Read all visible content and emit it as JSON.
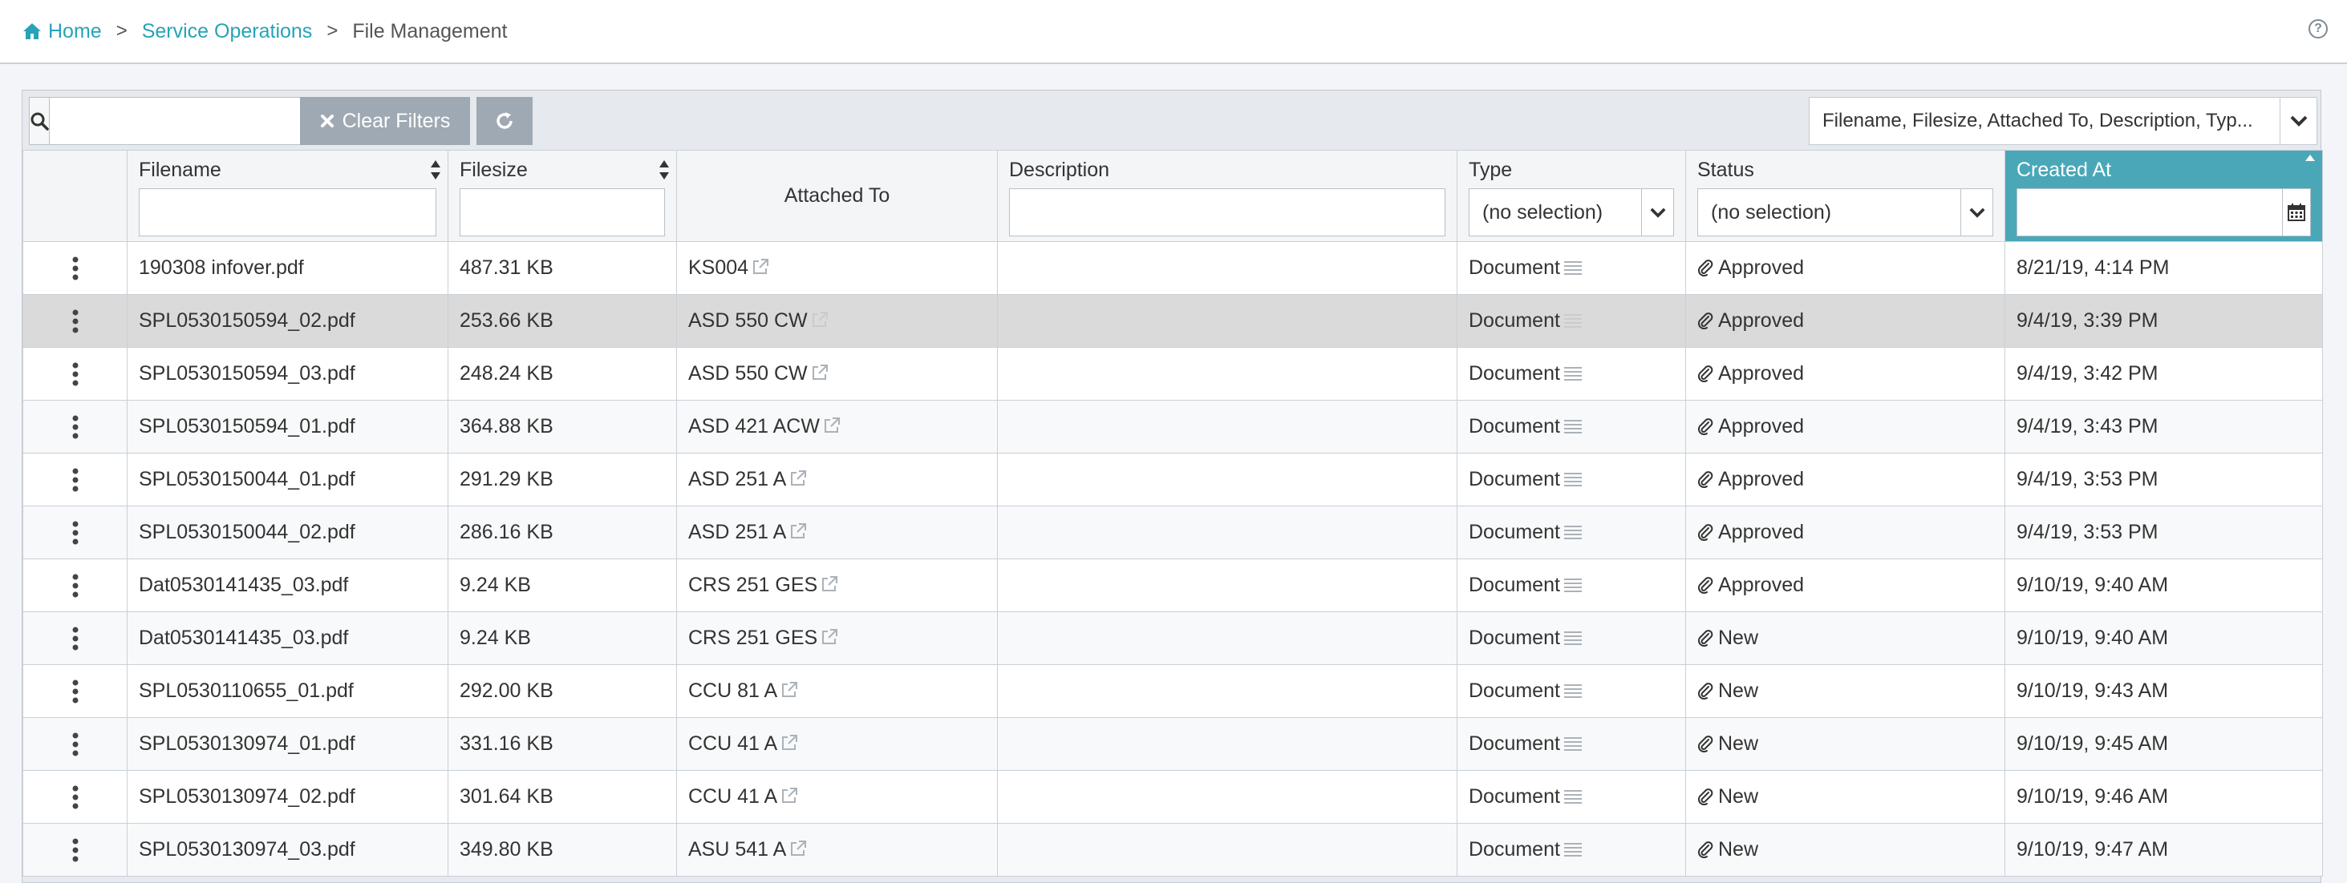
{
  "breadcrumb": {
    "home": "Home",
    "section": "Service Operations",
    "current": "File Management",
    "separator": ">"
  },
  "toolbar": {
    "search_value": "",
    "clear_filters_label": "Clear Filters",
    "columns_selected": "Filename, Filesize, Attached To, Description, Typ..."
  },
  "columns": {
    "filename": "Filename",
    "filesize": "Filesize",
    "attached_to": "Attached To",
    "description": "Description",
    "type": "Type",
    "status": "Status",
    "created_at": "Created At"
  },
  "filters": {
    "type_selected": "(no selection)",
    "status_selected": "(no selection)"
  },
  "rows": [
    {
      "filename": "190308 infover.pdf",
      "filesize": "487.31 KB",
      "attached_to": "KS004",
      "description": "",
      "type": "Document",
      "status": "Approved",
      "created_at": "8/21/19, 4:14 PM"
    },
    {
      "filename": "SPL0530150594_02.pdf",
      "filesize": "253.66 KB",
      "attached_to": "ASD 550 CW",
      "description": "",
      "type": "Document",
      "status": "Approved",
      "created_at": "9/4/19, 3:39 PM"
    },
    {
      "filename": "SPL0530150594_03.pdf",
      "filesize": "248.24 KB",
      "attached_to": "ASD 550 CW",
      "description": "",
      "type": "Document",
      "status": "Approved",
      "created_at": "9/4/19, 3:42 PM"
    },
    {
      "filename": "SPL0530150594_01.pdf",
      "filesize": "364.88 KB",
      "attached_to": "ASD 421 ACW",
      "description": "",
      "type": "Document",
      "status": "Approved",
      "created_at": "9/4/19, 3:43 PM"
    },
    {
      "filename": "SPL0530150044_01.pdf",
      "filesize": "291.29 KB",
      "attached_to": "ASD 251 A",
      "description": "",
      "type": "Document",
      "status": "Approved",
      "created_at": "9/4/19, 3:53 PM"
    },
    {
      "filename": "SPL0530150044_02.pdf",
      "filesize": "286.16 KB",
      "attached_to": "ASD 251 A",
      "description": "",
      "type": "Document",
      "status": "Approved",
      "created_at": "9/4/19, 3:53 PM"
    },
    {
      "filename": "Dat0530141435_03.pdf",
      "filesize": "9.24 KB",
      "attached_to": "CRS 251 GES",
      "description": "",
      "type": "Document",
      "status": "Approved",
      "created_at": "9/10/19, 9:40 AM"
    },
    {
      "filename": "Dat0530141435_03.pdf",
      "filesize": "9.24 KB",
      "attached_to": "CRS 251 GES",
      "description": "",
      "type": "Document",
      "status": "New",
      "created_at": "9/10/19, 9:40 AM"
    },
    {
      "filename": "SPL0530110655_01.pdf",
      "filesize": "292.00 KB",
      "attached_to": "CCU 81 A",
      "description": "",
      "type": "Document",
      "status": "New",
      "created_at": "9/10/19, 9:43 AM"
    },
    {
      "filename": "SPL0530130974_01.pdf",
      "filesize": "331.16 KB",
      "attached_to": "CCU 41 A",
      "description": "",
      "type": "Document",
      "status": "New",
      "created_at": "9/10/19, 9:45 AM"
    },
    {
      "filename": "SPL0530130974_02.pdf",
      "filesize": "301.64 KB",
      "attached_to": "CCU 41 A",
      "description": "",
      "type": "Document",
      "status": "New",
      "created_at": "9/10/19, 9:46 AM"
    },
    {
      "filename": "SPL0530130974_03.pdf",
      "filesize": "349.80 KB",
      "attached_to": "ASU 541 A",
      "description": "",
      "type": "Document",
      "status": "New",
      "created_at": "9/10/19, 9:47 AM"
    }
  ],
  "selected_row_index": 1,
  "colors": {
    "accent": "#27a3b7",
    "active_header": "#4aa7b8",
    "button_gray": "#9fa9b3",
    "selected_row": "#dadada"
  },
  "icons": {
    "home": "home-icon",
    "help": "help-icon",
    "search": "search-icon",
    "clear": "close-icon",
    "refresh": "refresh-icon",
    "dropdown": "chevron-down-icon",
    "calendar": "calendar-icon",
    "row_menu": "kebab-menu-icon",
    "external_link": "external-link-icon",
    "list": "list-icon",
    "attachment": "paperclip-icon"
  }
}
